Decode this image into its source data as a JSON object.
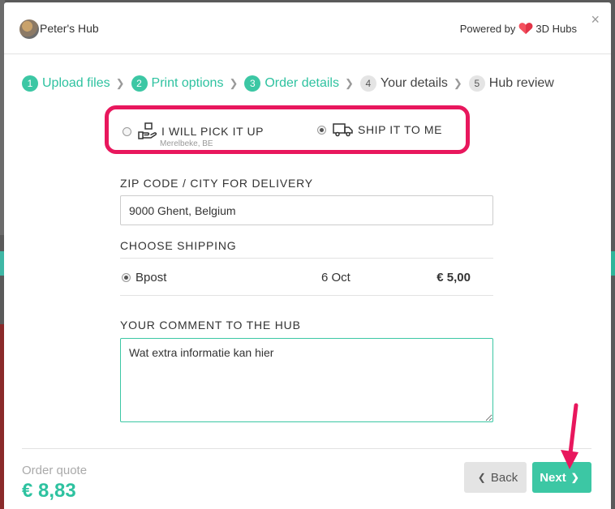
{
  "header": {
    "hub_name": "Peter's Hub",
    "powered_by": "Powered by",
    "brand": "3D Hubs",
    "brand_color": "#f4505e",
    "close_icon": "×"
  },
  "steps": [
    {
      "num": "1",
      "label": "Upload files",
      "state": "done"
    },
    {
      "num": "2",
      "label": "Print options",
      "state": "done"
    },
    {
      "num": "3",
      "label": "Order details",
      "state": "done"
    },
    {
      "num": "4",
      "label": "Your details",
      "state": "todo"
    },
    {
      "num": "5",
      "label": "Hub review",
      "state": "todo"
    }
  ],
  "delivery": {
    "pickup_label": "I WILL PICK IT UP",
    "pickup_location": "Merelbeke, BE",
    "ship_label": "SHIP IT TO ME",
    "selected": "ship",
    "highlight_color": "#e8175d"
  },
  "zip": {
    "label": "ZIP CODE / CITY FOR DELIVERY",
    "value": "9000 Ghent, Belgium"
  },
  "shipping": {
    "label": "CHOOSE SHIPPING",
    "options": [
      {
        "name": "Bpost",
        "date": "6 Oct",
        "price": "€ 5,00",
        "selected": true
      }
    ]
  },
  "comment": {
    "label": "YOUR COMMENT TO THE HUB",
    "value": "Wat extra informatie kan hier"
  },
  "footer": {
    "quote_label": "Order quote",
    "quote_value": "€ 8,83",
    "back_label": "Back",
    "next_label": "Next"
  },
  "accent_color": "#3cc7a4"
}
